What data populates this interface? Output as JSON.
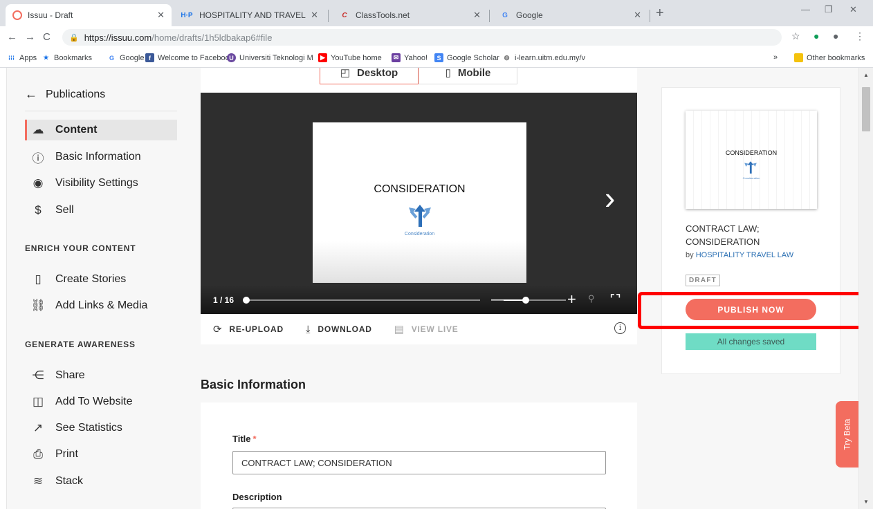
{
  "browser": {
    "tabs": [
      {
        "title": "Issuu - Draft",
        "favicon": "issuu-icon"
      },
      {
        "title": "HOSPITALITY AND TRAVEL | H5P",
        "favicon": "h5p-icon"
      },
      {
        "title": "ClassTools.net",
        "favicon": "classtools-icon"
      },
      {
        "title": "Google",
        "favicon": "google-icon"
      }
    ],
    "url_host": "https://issuu.com",
    "url_path": "/home/drafts/1h5ldbakap6#file",
    "bookmarks": [
      {
        "label": "Apps"
      },
      {
        "label": "Bookmarks"
      },
      {
        "label": "Google"
      },
      {
        "label": "Welcome to Faceboo"
      },
      {
        "label": "Universiti Teknologi M"
      },
      {
        "label": "YouTube home"
      },
      {
        "label": "Yahoo!"
      },
      {
        "label": "Google Scholar"
      },
      {
        "label": "i-learn.uitm.edu.my/v"
      }
    ],
    "more_bookmarks": "»",
    "other_bookmarks": "Other bookmarks"
  },
  "sidebar": {
    "back_label": "Publications",
    "items": [
      {
        "label": "Content",
        "icon": "upload-cloud-icon"
      },
      {
        "label": "Basic Information",
        "icon": "info-icon"
      },
      {
        "label": "Visibility Settings",
        "icon": "eye-icon"
      },
      {
        "label": "Sell",
        "icon": "dollar-icon"
      }
    ],
    "section_enrich": "ENRICH YOUR CONTENT",
    "enrich_items": [
      {
        "label": "Create Stories",
        "icon": "phone-icon"
      },
      {
        "label": "Add Links & Media",
        "icon": "link-icon"
      }
    ],
    "section_generate": "GENERATE AWARENESS",
    "generate_items": [
      {
        "label": "Share",
        "icon": "share-icon"
      },
      {
        "label": "Add To Website",
        "icon": "embed-icon"
      },
      {
        "label": "See Statistics",
        "icon": "trend-icon"
      },
      {
        "label": "Print",
        "icon": "print-icon"
      },
      {
        "label": "Stack",
        "icon": "stack-icon"
      }
    ]
  },
  "viewer": {
    "toggle_desktop": "Desktop",
    "toggle_mobile": "Mobile",
    "slide_title": "CONSIDERATION",
    "slide_caption": "Consideration",
    "page_count": "1 / 16",
    "progress": 0.0,
    "zoom_level": 0.35,
    "actions": {
      "reupload": "RE-UPLOAD",
      "download": "DOWNLOAD",
      "view_live": "VIEW LIVE"
    }
  },
  "form": {
    "heading": "Basic Information",
    "title_label": "Title",
    "required_mark": "*",
    "title_value": "CONTRACT LAW; CONSIDERATION",
    "description_label": "Description"
  },
  "side_panel": {
    "thumb_title": "CONSIDERATION",
    "thumb_caption": "Consideration",
    "pub_title": "CONTRACT LAW; CONSIDERATION",
    "by_prefix": "by",
    "author": "HOSPITALITY TRAVEL LAW",
    "status": "DRAFT",
    "publish_label": "PUBLISH NOW",
    "saved_label": "All changes saved"
  },
  "try_beta": "Try Beta",
  "colors": {
    "accent": "#f36d5f",
    "saved_bg": "#6fdcc5",
    "highlight": "#ff0000",
    "stage_bg": "#2e2e2e"
  }
}
